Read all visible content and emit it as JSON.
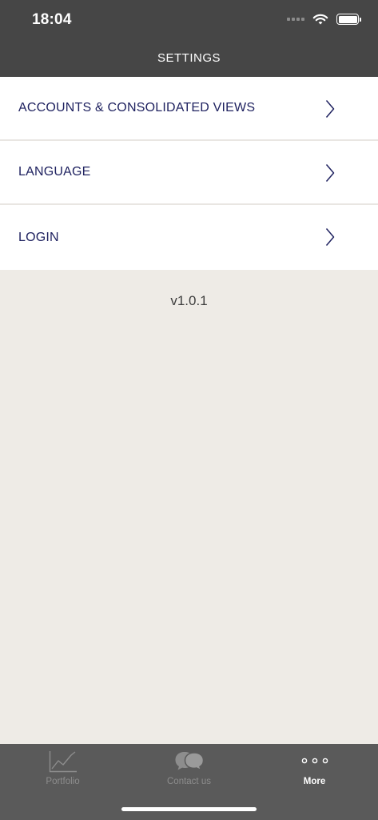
{
  "status_bar": {
    "time": "18:04",
    "icons": [
      "signal-icon",
      "wifi-icon",
      "battery-icon"
    ]
  },
  "nav": {
    "title": "SETTINGS"
  },
  "settings": {
    "items": [
      {
        "label": "ACCOUNTS & CONSOLIDATED VIEWS",
        "icon": "chevron-right-icon"
      },
      {
        "label": "LANGUAGE",
        "icon": "chevron-right-icon"
      },
      {
        "label": "LOGIN",
        "icon": "chevron-right-icon"
      }
    ]
  },
  "version": "v1.0.1",
  "tabbar": {
    "tabs": [
      {
        "label": "Portfolio",
        "icon": "line-chart-icon",
        "active": false
      },
      {
        "label": "Contact us",
        "icon": "chat-bubbles-icon",
        "active": false
      },
      {
        "label": "More",
        "icon": "more-dots-icon",
        "active": true
      }
    ]
  },
  "colors": {
    "header_bg": "#464646",
    "page_bg": "#eeebe6",
    "row_bg": "#ffffff",
    "row_text": "#1f2260",
    "tabbar_bg": "#5a5a5a",
    "tab_inactive": "#8d8d8d",
    "tab_active": "#ffffff"
  }
}
